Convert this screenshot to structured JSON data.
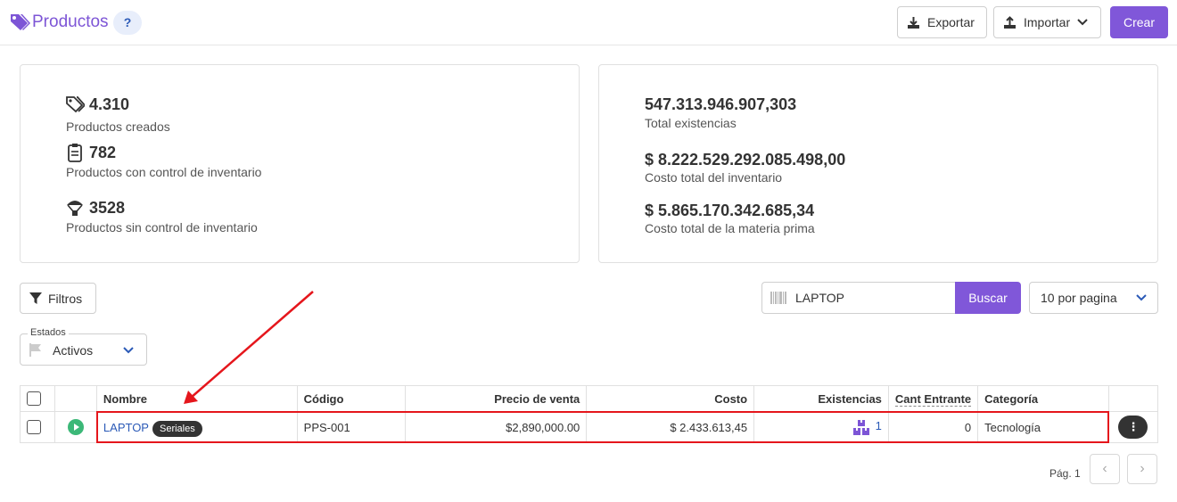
{
  "header": {
    "title": "Productos",
    "help_label": "?",
    "export_label": "Exportar",
    "import_label": "Importar",
    "create_label": "Crear",
    "accent": "#8057d9"
  },
  "summary_left": {
    "created_value": "4.310",
    "created_label": "Productos creados",
    "controlled_value": "782",
    "controlled_label": "Productos con control de inventario",
    "uncontrolled_value": "3528",
    "uncontrolled_label": "Productos sin control de inventario"
  },
  "summary_right": {
    "stock_value": "547.313.946.907,303",
    "stock_label": "Total existencias",
    "inventory_cost_value": "$ 8.222.529.292.085.498,00",
    "inventory_cost_label": "Costo total del inventario",
    "raw_cost_value": "$ 5.865.170.342.685,34",
    "raw_cost_label": "Costo total de la materia prima"
  },
  "toolbar": {
    "filters_label": "Filtros",
    "search_value": "LAPTOP",
    "search_button": "Buscar",
    "per_page": "10 por pagina",
    "status_legend": "Estados",
    "status_value": "Activos"
  },
  "table": {
    "headers": {
      "name": "Nombre",
      "code": "Código",
      "price": "Precio de venta",
      "cost": "Costo",
      "stock": "Existencias",
      "incoming": "Cant Entrante",
      "category": "Categoría"
    },
    "rows": [
      {
        "name": "LAPTOP",
        "badge": "Seriales",
        "code": "PPS-001",
        "price": "$2,890,000.00",
        "cost": "$ 2.433.613,45",
        "stock": "1",
        "incoming": "0",
        "category": "Tecnología"
      }
    ]
  },
  "pagination": {
    "label": "Pág. 1",
    "prev": "‹",
    "next": "›"
  }
}
